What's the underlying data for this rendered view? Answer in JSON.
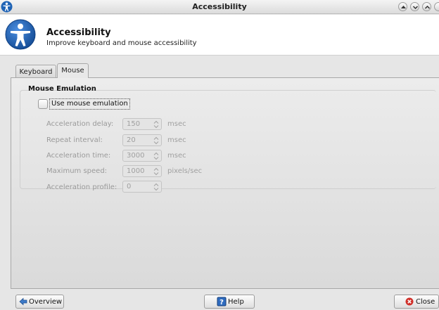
{
  "window": {
    "title": "Accessibility"
  },
  "header": {
    "title": "Accessibility",
    "subtitle": "Improve keyboard and mouse accessibility"
  },
  "tabs": [
    {
      "label": "Keyboard",
      "active": false
    },
    {
      "label": "Mouse",
      "active": true
    }
  ],
  "mouse_emulation": {
    "group_title": "Mouse Emulation",
    "checkbox_label": "Use mouse emulation",
    "checked": false,
    "fields": [
      {
        "label": "Acceleration delay:",
        "value": "150",
        "unit": "msec"
      },
      {
        "label": "Repeat interval:",
        "value": "20",
        "unit": "msec"
      },
      {
        "label": "Acceleration time:",
        "value": "3000",
        "unit": "msec"
      },
      {
        "label": "Maximum speed:",
        "value": "1000",
        "unit": "pixels/sec"
      },
      {
        "label": "Acceleration profile:",
        "value": "0",
        "unit": ""
      }
    ]
  },
  "footer": {
    "overview_label": "Overview",
    "help_label": "Help",
    "close_label": "Close"
  },
  "colors": {
    "accent_blue": "#1f63b5",
    "close_red": "#d0302a",
    "disabled_text": "#9a9a9a"
  },
  "icons": {
    "app": "accessibility-icon",
    "overview": "arrow-left-icon",
    "help": "help-icon",
    "close": "close-icon"
  }
}
